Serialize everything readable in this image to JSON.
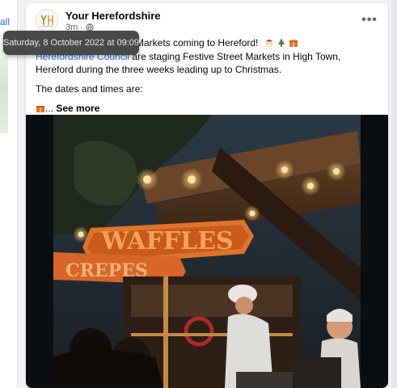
{
  "left_fragment": "all",
  "post": {
    "page_name": "Your Herefordshire",
    "timestamp": "3m",
    "separator": "·",
    "tooltip": "Saturday, 8 October 2022 at 09:09",
    "title_visible_part": "Markets coming to Hereford!",
    "link_text": "Herefordshire Council",
    "body_after_link": " are staging Festive Street Markets in High Town, Hereford during the three weeks leading up to Christmas.",
    "dates_line": "The dates and times are:",
    "ellipsis": "...",
    "see_more": "See more"
  },
  "icons": {
    "avatar": "your-herefordshire-logo",
    "globe": "globe-icon",
    "more": "more-options-icon",
    "emoji_1": "santa-icon",
    "emoji_2": "christmas-tree-icon",
    "emoji_3": "gift-icon"
  },
  "photo": {
    "signs": [
      "WAFFLES",
      "CREPES"
    ]
  },
  "colors": {
    "link": "#216fdb",
    "text": "#050505",
    "muted": "#65676b",
    "sign_orange": "#e0742a"
  }
}
